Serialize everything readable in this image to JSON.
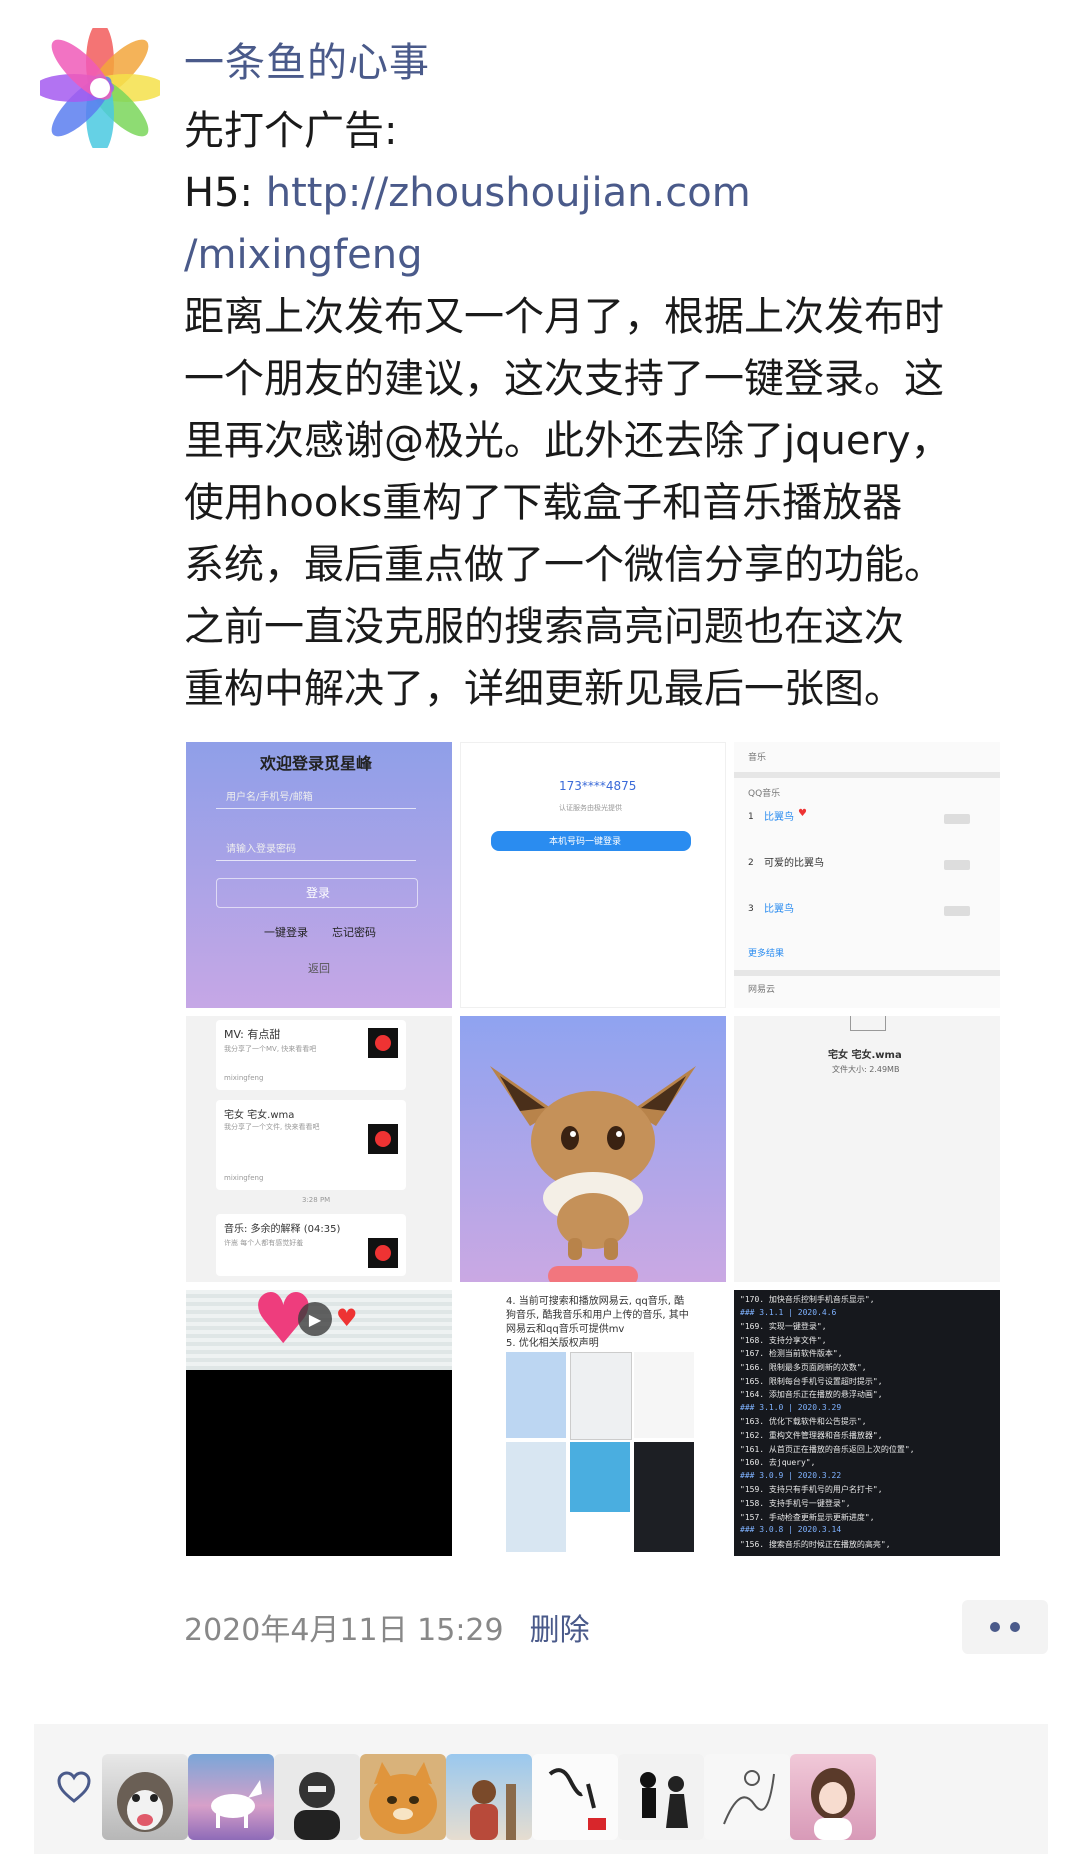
{
  "post": {
    "author": "一条鱼的心事",
    "lines": [
      {
        "text": "先打个广告:",
        "link": false
      },
      {
        "text": "H5: ",
        "link": false,
        "suffix": "http://zhoushoujian.com"
      },
      {
        "text": "/mixingfeng",
        "link": true
      },
      {
        "text": "距离上次发布又一个月了，根据上次发布时",
        "link": false
      },
      {
        "text": "一个朋友的建议，这次支持了一键登录。这",
        "link": false
      },
      {
        "text": "里再次感谢@极光。此外还去除了jquery，",
        "link": false
      },
      {
        "text": "使用hooks重构了下载盒子和音乐播放器",
        "link": false
      },
      {
        "text": "系统，最后重点做了一个微信分享的功能。",
        "link": false
      },
      {
        "text": "之前一直没克服的搜索高亮问题也在这次",
        "link": false
      },
      {
        "text": "重构中解决了，详细更新见最后一张图。",
        "link": false
      }
    ],
    "timestamp": "2020年4月11日 15:29",
    "delete_label": "删除"
  },
  "images": {
    "img1": {
      "title": "欢迎登录觅星峰",
      "field1": "用户名/手机号/邮箱",
      "field2": "请输入登录密码",
      "login": "登录",
      "one_key": "一键登录",
      "forgot": "忘记密码",
      "back": "返回"
    },
    "img2": {
      "phone": "173****4875",
      "hint": "认证服务由极光提供",
      "button": "本机号码一键登录"
    },
    "img3": {
      "header": "音乐",
      "section": "QQ音乐",
      "items": [
        "比翼鸟",
        "可爱的比翼鸟",
        "比翼鸟"
      ],
      "more": "更多结果",
      "footer": "网易云"
    },
    "img4": {
      "items": [
        {
          "title": "MV: 有点甜",
          "sub": "我分享了一个MV, 快来看看吧",
          "user": "mixingfeng"
        },
        {
          "title": "宅女 宅女.wma",
          "sub": "我分享了一个文件, 快来看看吧",
          "user": "mixingfeng"
        },
        {
          "title": "音乐: 多余的解释 (04:35)",
          "sub": "许嵩 每个人都有感觉好羞"
        }
      ],
      "time": "3:28 PM"
    },
    "img6": {
      "file": "宅女 宅女.wma",
      "size": "文件大小: 2.49MB"
    },
    "img8": {
      "text": [
        "4. 当前可搜索和播放网易云, qq音乐, 酷",
        "狗音乐, 酷我音乐和用户上传的音乐, 其中",
        "网易云和qq音乐可提供mv",
        "5. 优化相关版权声明"
      ]
    },
    "img9": {
      "lines": [
        "\"170. 加快音乐控制手机音乐显示\",",
        "### 3.1.1 | 2020.4.6",
        "\"169. 实现一键登录\",",
        "\"168. 支持分享文件\",",
        "\"167. 检测当前软件版本\",",
        "\"166. 限制最多页面刷新的次数\",",
        "\"165. 限制每台手机号设置超时提示\",",
        "\"164. 添加音乐正在播放的悬浮动画\",",
        "### 3.1.0 | 2020.3.29",
        "\"163. 优化下载软件和公告提示\",",
        "\"162. 重构文件管理器和音乐播放器\",",
        "\"161. 从首页正在播放的音乐返回上次的位置\",",
        "\"160. 去jquery\",",
        "### 3.0.9 | 2020.3.22",
        "\"159. 支持只有手机号的用户名打卡\",",
        "\"158. 支持手机号一键登录\",",
        "\"157. 手动检查更新显示更新进度\",",
        "### 3.0.8 | 2020.3.14",
        "\"156. 搜索音乐的时候正在播放的高亮\","
      ]
    }
  },
  "colors": {
    "link": "#4a5a8a",
    "meta": "#888888",
    "accent_heart": "#e84a7f"
  },
  "likes_icon": "heart-outline-icon",
  "likers": [
    "husky",
    "white-horse",
    "sketch-person",
    "orange-cat",
    "person-outdoor",
    "calligraphy",
    "dancers",
    "ink-sketch",
    "girl-portrait"
  ]
}
